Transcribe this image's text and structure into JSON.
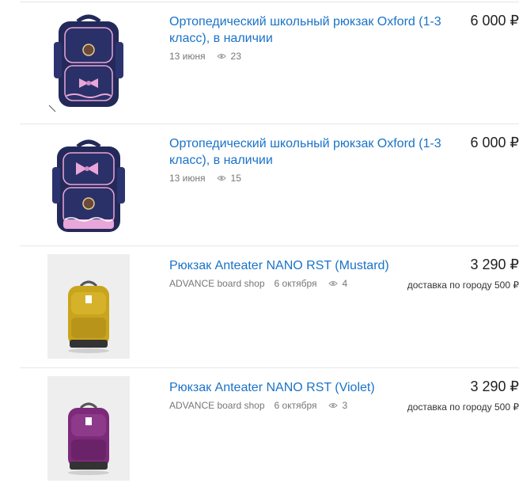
{
  "listings": [
    {
      "title": "Ортопедический школьный рюкзак Oxford (1-3 класс), в наличии",
      "price": "6 000 ₽",
      "date": "13 июня",
      "views": "23",
      "image_icon": "navy-backpack-icon"
    },
    {
      "title": "Ортопедический школьный рюкзак Oxford (1-3 класс), в наличии",
      "price": "6 000 ₽",
      "date": "13 июня",
      "views": "15",
      "image_icon": "navy-backpack-icon"
    },
    {
      "title": "Рюкзак Anteater NANO RST (Mustard)",
      "price": "3 290 ₽",
      "shop": "ADVANCE board shop",
      "date": "6 октября",
      "views": "4",
      "delivery": "доставка по городу 500 ₽",
      "image_icon": "mustard-backpack-icon"
    },
    {
      "title": "Рюкзак Anteater NANO RST (Violet)",
      "price": "3 290 ₽",
      "shop": "ADVANCE board shop",
      "date": "6 октября",
      "views": "3",
      "delivery": "доставка по городу 500 ₽",
      "image_icon": "violet-backpack-icon"
    }
  ],
  "colors": {
    "link": "#1a73c8",
    "navy": "#232a5a",
    "pink": "#e9a6d8",
    "mustard": "#c9a51c",
    "violet": "#7d2a7a"
  }
}
